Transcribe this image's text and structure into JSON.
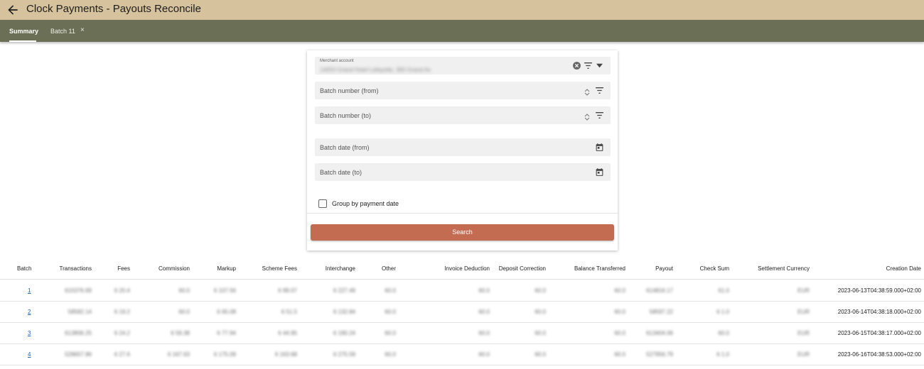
{
  "header": {
    "title": "Clock Payments - Payouts Reconcile"
  },
  "tabs": [
    {
      "label": "Summary",
      "active": true
    },
    {
      "label": "Batch 11",
      "active": false,
      "closable": true
    }
  ],
  "tab_close_glyph": "×",
  "form": {
    "merchant": {
      "label": "Merchant account",
      "value": "14053 Grand Hotel Lafayette, 360 Grand Av"
    },
    "batch_from": {
      "label": "Batch number (from)"
    },
    "batch_to": {
      "label": "Batch number (to)"
    },
    "date_from": {
      "label": "Batch date (from)"
    },
    "date_to": {
      "label": "Batch date (to)"
    },
    "group_by_payment_date": {
      "label": "Group by payment date",
      "checked": false
    },
    "search_label": "Search"
  },
  "table": {
    "headers": [
      "Batch",
      "Transactions",
      "Fees",
      "Commission",
      "Markup",
      "Scheme Fees",
      "Interchange",
      "Other",
      "Invoice Deduction",
      "Deposit Correction",
      "Balance Transferred",
      "Payout",
      "Check Sum",
      "Settlement Currency",
      "Creation Date"
    ],
    "rows": [
      [
        "1",
        "615376.69",
        "6 20.4",
        "60.0",
        "6 107.56",
        "6 99.07",
        "6 227.49",
        "60.0",
        "60.0",
        "60.0",
        "60.0",
        "614816.17",
        "61.0",
        "EUR",
        "2023-06-13T04:38:59.000+02:00"
      ],
      [
        "2",
        "58582.14",
        "6 19.2",
        "60.0",
        "6 65.08",
        "6 51.5",
        "6 132.84",
        "60.0",
        "60.0",
        "60.0",
        "60.0",
        "58597.22",
        "6 1.0",
        "EUR",
        "2023-06-14T04:38:18.000+02:00"
      ],
      [
        "3",
        "613806.25",
        "6 24.2",
        "6 59.38",
        "6 77.94",
        "6 44.95",
        "6 190.24",
        "60.0",
        "60.0",
        "60.0",
        "60.0",
        "613404.06",
        "60.0",
        "EUR",
        "2023-06-15T04:38:17.000+02:00"
      ],
      [
        "4",
        "528657.86",
        "6 27.6",
        "6 167.63",
        "6 175.09",
        "6 163.68",
        "6 275.59",
        "60.0",
        "60.0",
        "60.0",
        "60.0",
        "527956.79",
        "6 1.0",
        "EUR",
        "2023-06-16T04:38:53.000+02:00"
      ]
    ]
  },
  "icons": {
    "back": "arrow-left-icon",
    "clear": "clear-circle-icon",
    "filter": "filter-icon",
    "dropdown": "caret-down-icon",
    "calendar": "calendar-icon",
    "spinner": "number-spinner-icon"
  }
}
